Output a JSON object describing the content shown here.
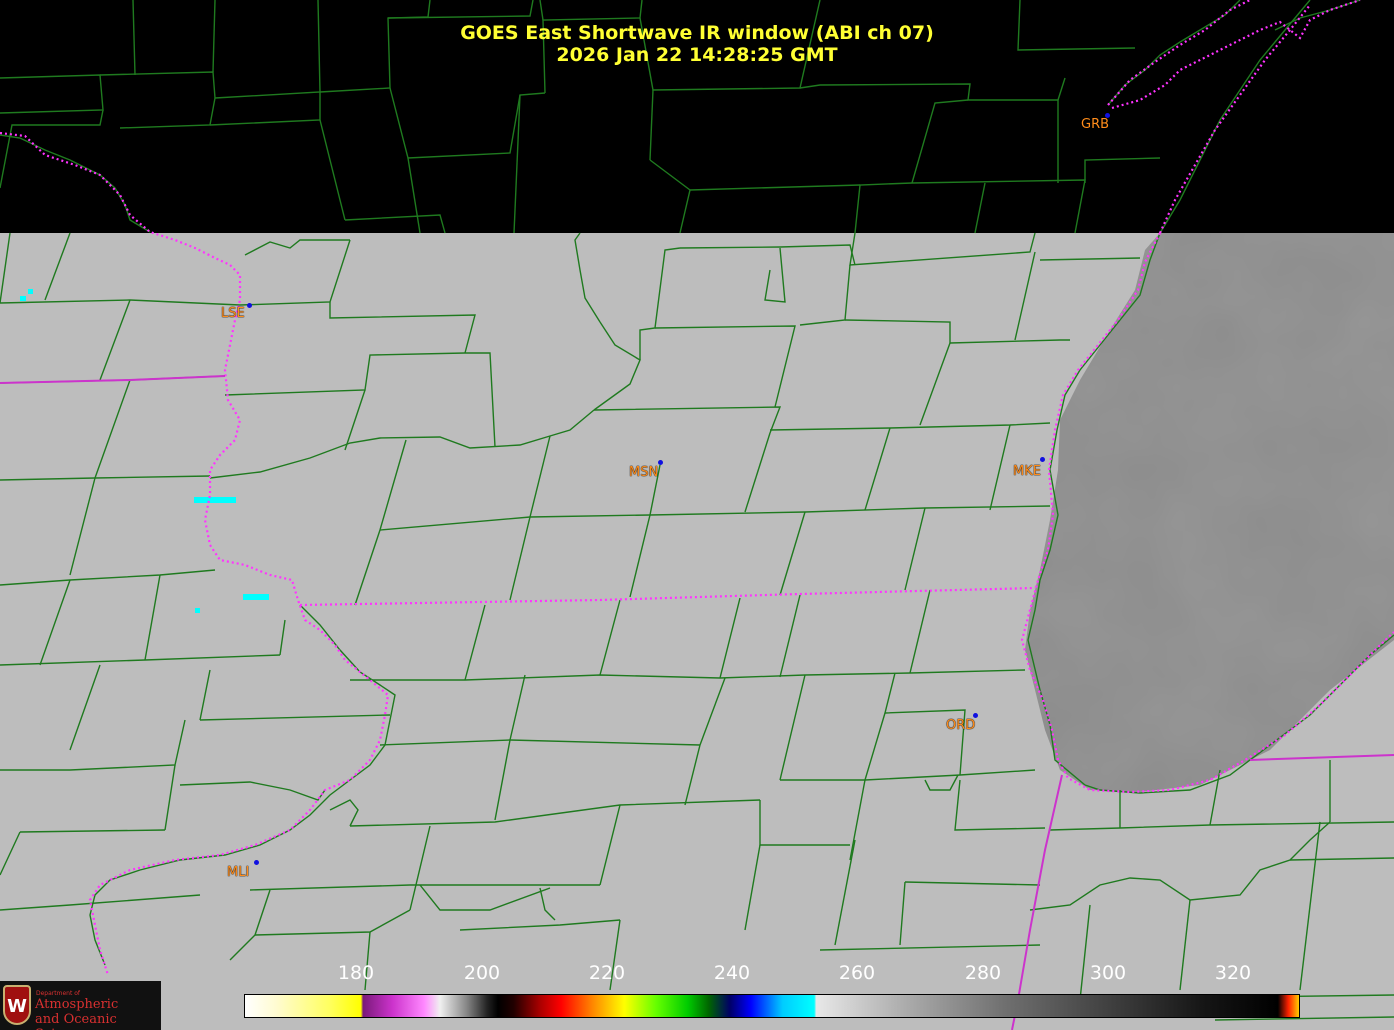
{
  "title": {
    "line1": "GOES East Shortwave IR window (ABI ch 07)",
    "line2": "2026 Jan 22  14:28:25 GMT"
  },
  "stations": [
    {
      "id": "GRB"
    },
    {
      "id": "LSE"
    },
    {
      "id": "MSN"
    },
    {
      "id": "MKE"
    },
    {
      "id": "ORD"
    },
    {
      "id": "MLI"
    }
  ],
  "colorbar": {
    "ticks": [
      "180",
      "200",
      "220",
      "240",
      "260",
      "280",
      "300",
      "320"
    ]
  },
  "logo": {
    "crest": "W",
    "dept": "Department of",
    "line1": "Atmospheric",
    "line2": "and Oceanic Sciences"
  },
  "colors": {
    "title": "#ffff33",
    "county_lines": "#1f7a1f",
    "state_lines": "#ff33ff",
    "station_label": "#ff8c1a",
    "station_dot": "#1010e0"
  }
}
